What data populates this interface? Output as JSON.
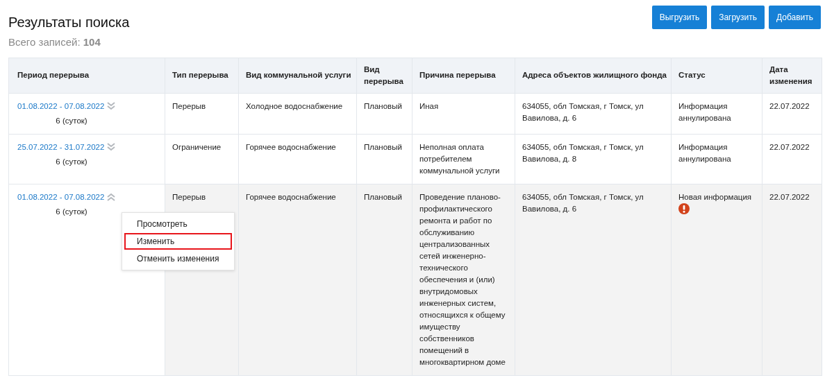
{
  "title": "Результаты поиска",
  "total": {
    "label": "Всего записей:",
    "count": "104"
  },
  "buttons": [
    "Выгрузить",
    "Загрузить",
    "Добавить"
  ],
  "table": {
    "columns": [
      "Период перерыва",
      "Тип перерыва",
      "Вид коммунальной услуги",
      "Вид перерыва",
      "Причина перерыва",
      "Адреса объектов жилищного фонда",
      "Статус",
      "Дата изменения"
    ],
    "rows": [
      {
        "period": "01.08.2022 - 07.08.2022",
        "duration": "6 (суток)",
        "expanded": false,
        "selected": false,
        "type": "Перерыв",
        "service": "Холодное водоснабжение",
        "kind": "Плановый",
        "reason": "Иная",
        "address": "634055, обл Томская, г Томск, ул Вавилова, д. 6",
        "status": "Информация аннулирована",
        "warning": false,
        "date": "22.07.2022"
      },
      {
        "period": "25.07.2022 - 31.07.2022",
        "duration": "6 (суток)",
        "expanded": false,
        "selected": false,
        "type": "Ограничение",
        "service": "Горячее водоснабжение",
        "kind": "Плановый",
        "reason": "Неполная оплата потребителем коммунальной услуги",
        "address": "634055, обл Томская, г Томск, ул Вавилова, д. 8",
        "status": "Информация аннулирована",
        "warning": false,
        "date": "22.07.2022"
      },
      {
        "period": "01.08.2022 - 07.08.2022",
        "duration": "6 (суток)",
        "expanded": true,
        "selected": true,
        "type": "Перерыв",
        "service": "Горячее водоснабжение",
        "kind": "Плановый",
        "reason": "Проведение планово-профилактического ремонта и работ по обслуживанию централизованных сетей инженерно-технического обеспечения и (или) внутридомовых инженерных систем, относящихся к общему имуществу собственников помещений в многоквартирном доме",
        "address": "634055, обл Томская, г Томск, ул Вавилова, д. 6",
        "status": "Новая информация",
        "warning": true,
        "date": "22.07.2022",
        "menu": [
          {
            "label": "Просмотреть",
            "selected": false
          },
          {
            "label": "Изменить",
            "selected": true
          },
          {
            "label": "Отменить изменения",
            "selected": false
          }
        ]
      }
    ]
  }
}
